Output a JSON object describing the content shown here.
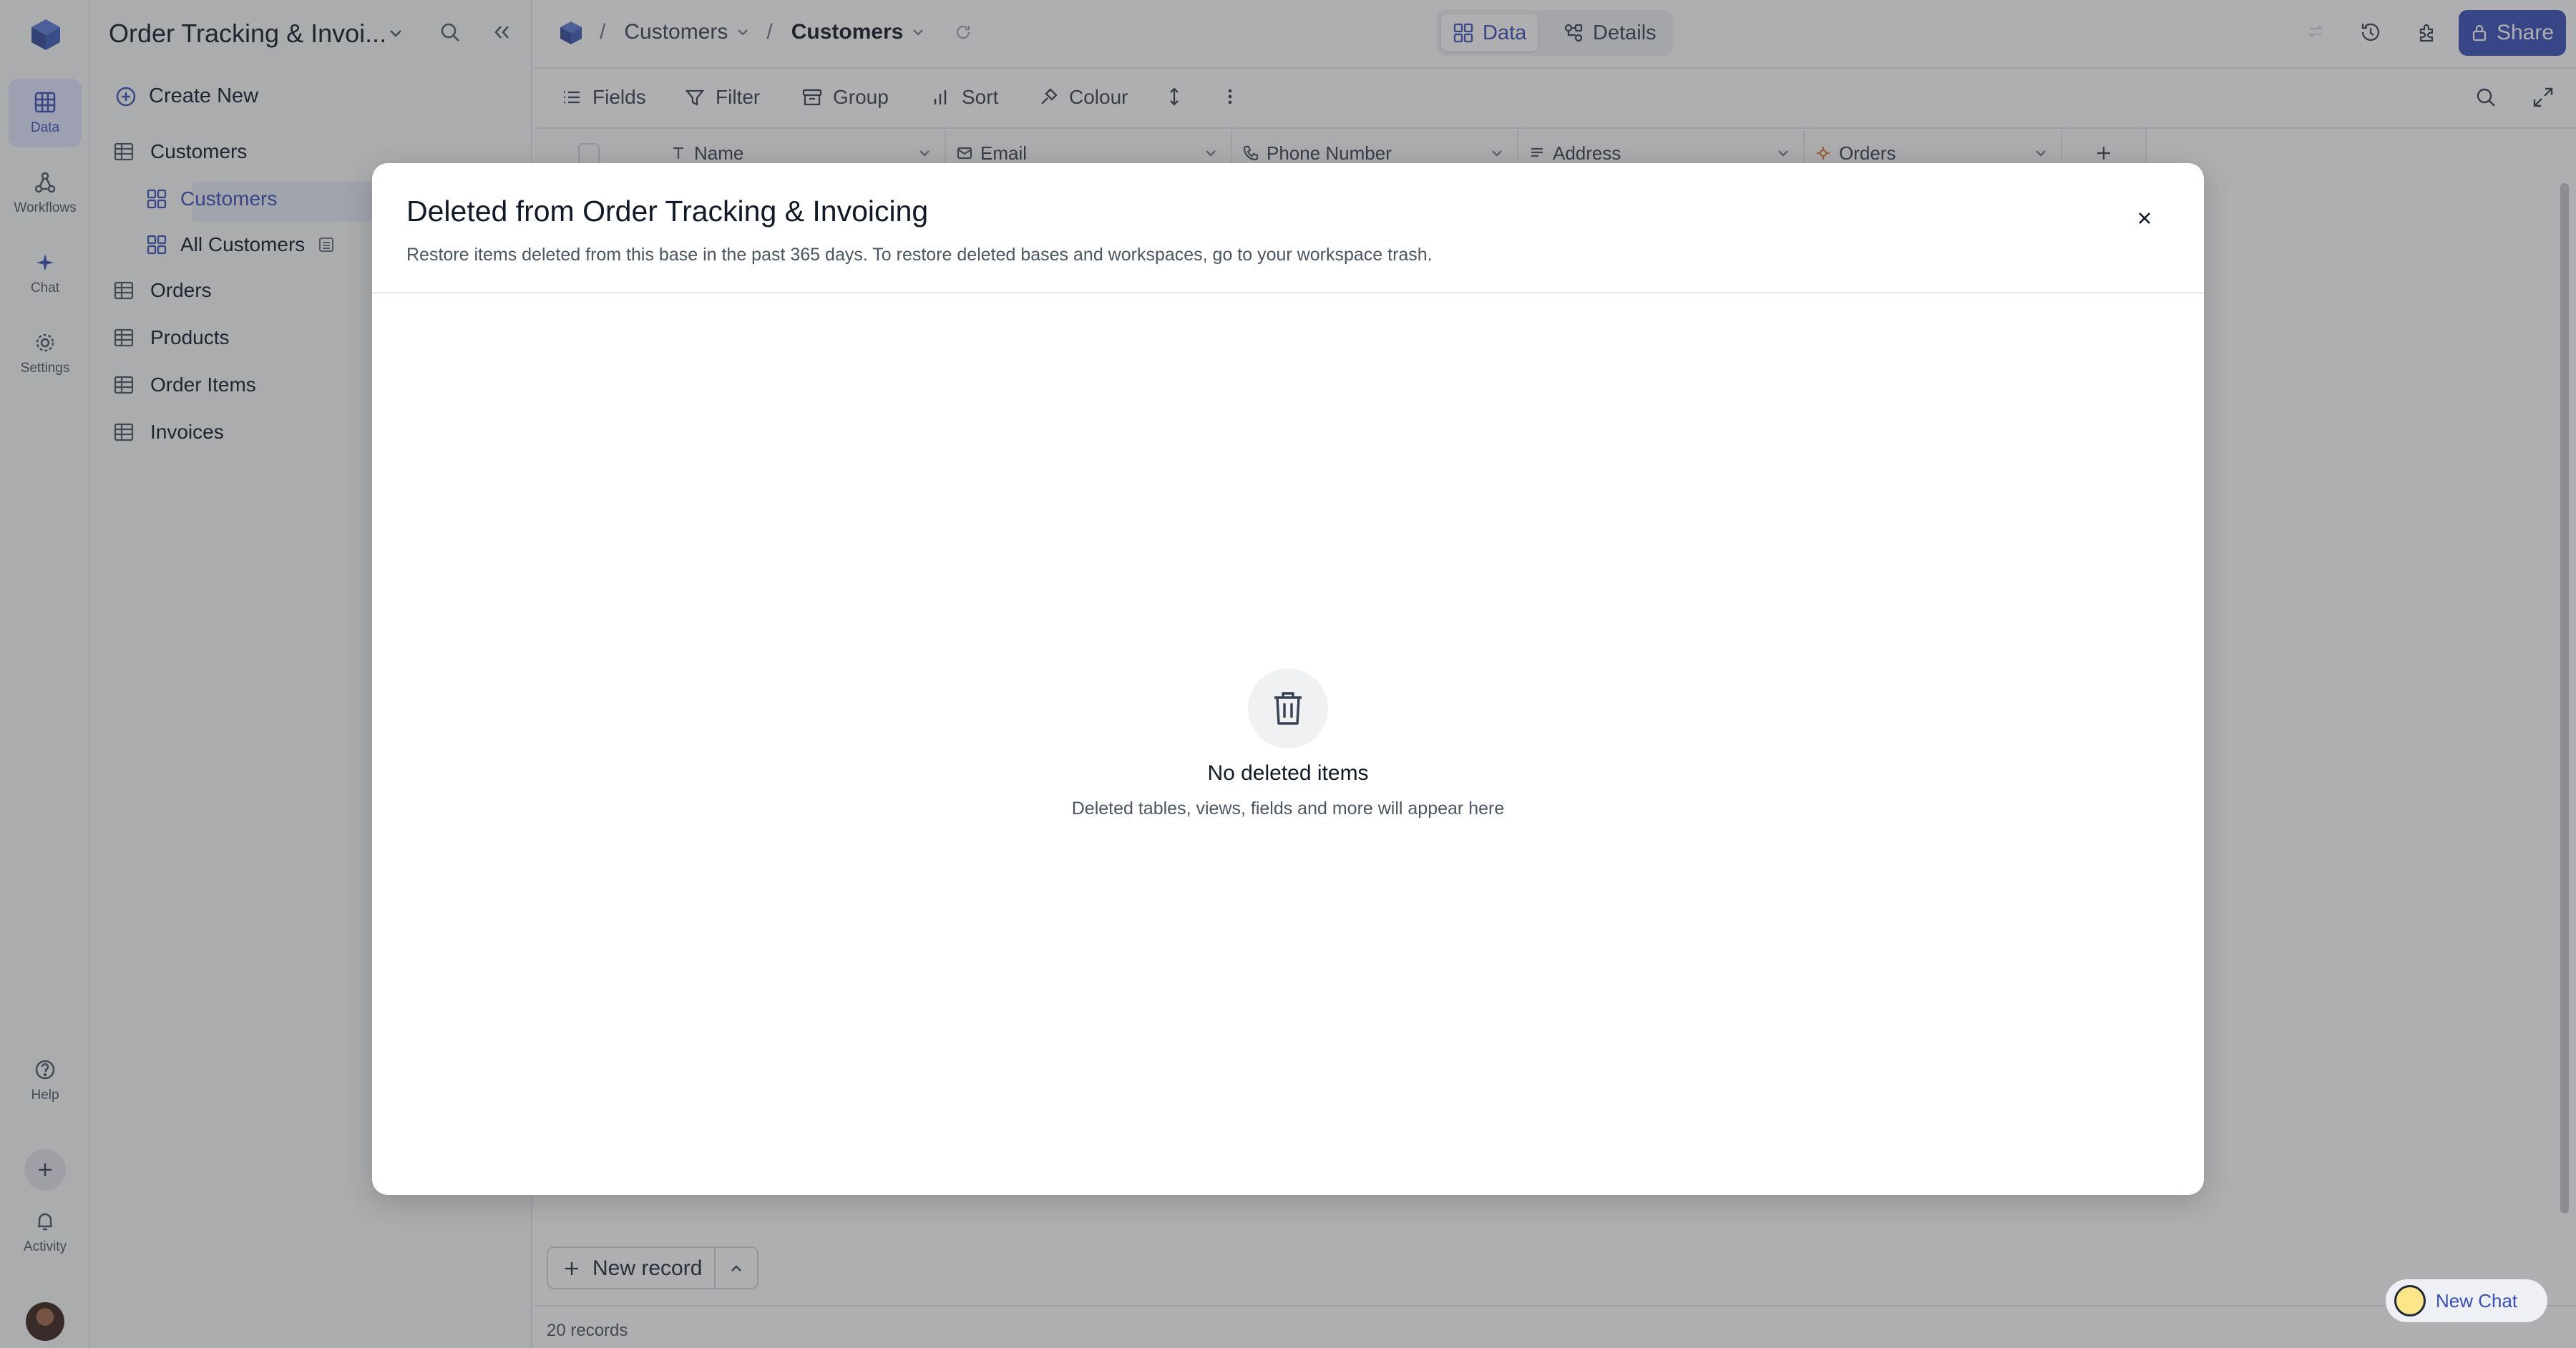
{
  "rail": {
    "items": [
      {
        "label": "Data",
        "icon": "grid-icon"
      },
      {
        "label": "Workflows",
        "icon": "workflow-icon"
      },
      {
        "label": "Chat",
        "icon": "sparkle-icon"
      },
      {
        "label": "Settings",
        "icon": "gear-icon"
      }
    ],
    "help_label": "Help",
    "activity_label": "Activity"
  },
  "sidebar": {
    "base_title": "Order Tracking & Invoi...",
    "create_new_label": "Create New",
    "tables": [
      {
        "label": "Customers",
        "views": [
          {
            "label": "Customers"
          },
          {
            "label": "All Customers"
          }
        ]
      },
      {
        "label": "Orders"
      },
      {
        "label": "Products"
      },
      {
        "label": "Order Items"
      },
      {
        "label": "Invoices"
      }
    ]
  },
  "topbar": {
    "breadcrumb": {
      "table": "Customers",
      "view": "Customers"
    },
    "tabs": [
      {
        "label": "Data"
      },
      {
        "label": "Details"
      }
    ],
    "share_label": "Share"
  },
  "toolbar": {
    "fields_label": "Fields",
    "filter_label": "Filter",
    "group_label": "Group",
    "sort_label": "Sort",
    "colour_label": "Colour"
  },
  "grid": {
    "columns": [
      {
        "label": "Name",
        "icon": "text-icon"
      },
      {
        "label": "Email",
        "icon": "mail-icon"
      },
      {
        "label": "Phone Number",
        "icon": "phone-icon"
      },
      {
        "label": "Address",
        "icon": "long-text-icon"
      },
      {
        "label": "Orders",
        "icon": "link-icon"
      }
    ],
    "new_record_label": "New record",
    "record_count": "20 records"
  },
  "new_chat_label": "New Chat",
  "modal": {
    "title": "Deleted from Order Tracking & Invoicing",
    "subtitle": "Restore items deleted from this base in the past 365 days. To restore deleted bases and workspaces, go to your workspace trash.",
    "empty_title": "No deleted items",
    "empty_subtitle": "Deleted tables, views, fields and more will appear here"
  },
  "colors": {
    "accent": "#3a4fb7",
    "overlay": "rgba(55,55,60,0.40)"
  }
}
